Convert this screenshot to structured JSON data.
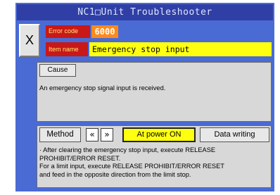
{
  "window": {
    "title": "NC1□Unit Troubleshooter"
  },
  "header": {
    "close_label": "X",
    "error_code_label": "Error code",
    "error_code_value": "6000",
    "item_name_label": "Item name",
    "item_name_value": "Emergency stop input"
  },
  "cause": {
    "tab_label": "Cause",
    "text": "An emergency stop signal input is received."
  },
  "method": {
    "tab_label": "Method",
    "prev_label": "«",
    "next_label": "»",
    "power_on_label": "At power ON",
    "data_writing_label": "Data writing",
    "lines": [
      "· After clearing the emergency stop input, execute RELEASE",
      "PROHIBIT/ERROR RESET.",
      "For a limit input, execute RELEASE PROHIBIT/ERROR RESET",
      "and feed in the opposite direction from the limit stop."
    ]
  },
  "colors": {
    "frame": "#4a6bd4",
    "titlebar": "#2f3fa6",
    "label_bg": "#c81818",
    "error_code_bg": "#ff8a1c",
    "highlight_yellow": "#ffff10"
  }
}
